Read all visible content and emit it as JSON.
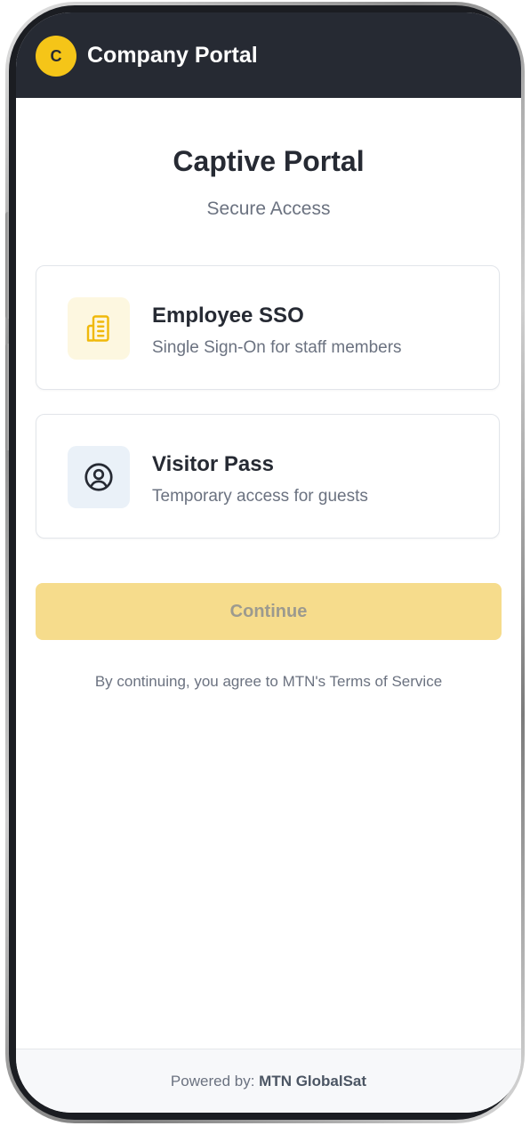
{
  "header": {
    "logo_letter": "C",
    "title": "Company Portal"
  },
  "main": {
    "title": "Captive Portal",
    "subtitle": "Secure Access",
    "options": [
      {
        "title": "Employee SSO",
        "description": "Single Sign-On for staff members",
        "icon": "building-icon",
        "icon_color": "#f0b90b",
        "icon_bg": "#fdf7e0"
      },
      {
        "title": "Visitor Pass",
        "description": "Temporary access for guests",
        "icon": "user-circle-icon",
        "icon_color": "#262a33",
        "icon_bg": "#eaf1f8"
      }
    ],
    "continue_label": "Continue",
    "terms": "By continuing, you agree to MTN's Terms of Service"
  },
  "footer": {
    "prefix": "Powered by: ",
    "brand": "MTN GlobalSat"
  },
  "colors": {
    "header_bg": "#262a33",
    "accent": "#f5c518",
    "continue_disabled_bg": "#f6dc8c"
  }
}
